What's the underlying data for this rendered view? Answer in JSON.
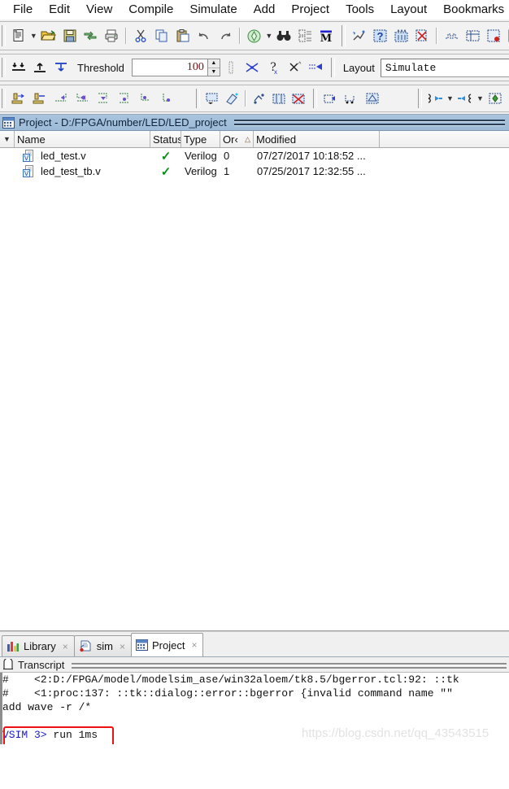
{
  "menu": {
    "items": [
      "File",
      "Edit",
      "View",
      "Compile",
      "Simulate",
      "Add",
      "Project",
      "Tools",
      "Layout",
      "Bookmarks"
    ]
  },
  "toolbar1": {
    "group1": [
      {
        "name": "new-document-icon",
        "label": "New"
      },
      {
        "name": "new-document-dropdown-icon",
        "label": "New menu"
      },
      {
        "name": "open-folder-icon",
        "label": "Open"
      },
      {
        "name": "save-icon",
        "label": "Save"
      },
      {
        "name": "reload-icon",
        "label": "Reload"
      },
      {
        "name": "print-icon",
        "label": "Print"
      }
    ],
    "group2": [
      {
        "name": "cut-icon",
        "label": "Cut"
      },
      {
        "name": "copy-icon",
        "label": "Copy"
      },
      {
        "name": "paste-icon",
        "label": "Paste"
      },
      {
        "name": "undo-icon",
        "label": "Undo"
      },
      {
        "name": "redo-icon",
        "label": "Redo"
      }
    ],
    "group3": [
      {
        "name": "compile-icon",
        "label": "Compile"
      },
      {
        "name": "compile-dropdown-icon",
        "label": "Compile menu"
      },
      {
        "name": "find-icon",
        "label": "Find"
      },
      {
        "name": "column-layout-icon",
        "label": "Columns"
      },
      {
        "name": "memory-icon",
        "label": "M"
      }
    ],
    "group4": [
      {
        "name": "simulate-icon",
        "label": "Simulate"
      },
      {
        "name": "wave-compare-icon",
        "label": "Compare"
      },
      {
        "name": "dataflow-icon",
        "label": "Dataflow"
      },
      {
        "name": "coverage-report-icon",
        "label": "Coverage report"
      },
      {
        "name": "delete-report-icon",
        "label": "Delete report"
      }
    ]
  },
  "toolbar2": {
    "icons_left": [
      {
        "name": "collapse-all-icon",
        "label": "Collapse all"
      },
      {
        "name": "expand-up-icon",
        "label": "Expand up"
      },
      {
        "name": "expand-down-icon",
        "label": "Expand down"
      }
    ],
    "threshold_label": "Threshold",
    "threshold_value": "100",
    "icons_right": [
      {
        "name": "column-filter-icon",
        "label": "Filter columns"
      },
      {
        "name": "dataflow-expand-icon",
        "label": "Expand net"
      },
      {
        "name": "unknown-signal-icon",
        "label": "Show unknowns"
      },
      {
        "name": "trace-x-icon",
        "label": "Trace X"
      },
      {
        "name": "step-into-icon",
        "label": "Step into"
      }
    ],
    "layout_label": "Layout",
    "layout_value": "Simulate"
  },
  "toolbar3": {
    "group1": [
      {
        "name": "step-in-icon",
        "label": "Step in"
      },
      {
        "name": "step-out-icon",
        "label": "Step out"
      },
      {
        "name": "jump-prev-icon",
        "label": "Previous"
      },
      {
        "name": "jump-next-icon",
        "label": "Next"
      },
      {
        "name": "expand-net-down-icon",
        "label": "Expand down"
      },
      {
        "name": "expand-net-right-icon",
        "label": "Expand right"
      },
      {
        "name": "trace-signal-icon",
        "label": "Trace signal"
      },
      {
        "name": "trace-event-icon",
        "label": "Trace event"
      }
    ],
    "group2": [
      {
        "name": "wave-add-icon",
        "label": "Add wave"
      },
      {
        "name": "wave-erase-icon",
        "label": "Erase wave"
      }
    ],
    "group3": [
      {
        "name": "restart-icon",
        "label": "Restart"
      },
      {
        "name": "dataflow-window-icon",
        "label": "Dataflow window"
      },
      {
        "name": "break-icon",
        "label": "Break"
      }
    ],
    "group4": [
      {
        "name": "run-icon",
        "label": "Run"
      },
      {
        "name": "run-continue-icon",
        "label": "Continue run"
      },
      {
        "name": "run-all-icon",
        "label": "Run all"
      }
    ],
    "group5": [
      {
        "name": "zoom-prev-icon",
        "label": "Zoom previous"
      },
      {
        "name": "zoom-prev-dropdown-icon",
        "label": "Zoom previous menu"
      },
      {
        "name": "zoom-next-icon",
        "label": "Zoom next"
      },
      {
        "name": "zoom-next-dropdown-icon",
        "label": "Zoom next menu"
      },
      {
        "name": "zoom-fit-icon",
        "label": "Zoom fit"
      }
    ]
  },
  "project": {
    "title": "Project - D:/FPGA/number/LED/LED_project",
    "columns": [
      "Name",
      "Status",
      "Type",
      "Or‹",
      "Modified"
    ],
    "sort_column": "Or‹",
    "rows": [
      {
        "name": "led_test.v",
        "status": "✓",
        "type": "Verilog",
        "order": "0",
        "modified": "07/27/2017 10:18:52 ..."
      },
      {
        "name": "led_test_tb.v",
        "status": "✓",
        "type": "Verilog",
        "order": "1",
        "modified": "07/25/2017 12:32:55 ..."
      }
    ]
  },
  "tabs": [
    {
      "label": "Library",
      "icon": "library-icon",
      "active": false,
      "close": "×"
    },
    {
      "label": "sim",
      "icon": "sim-icon",
      "active": false,
      "close": "×"
    },
    {
      "label": "Project",
      "icon": "project-icon",
      "active": true,
      "close": "×"
    }
  ],
  "transcript": {
    "title": "Transcript",
    "lines": [
      {
        "prefix": "#",
        "text": "    <2:D:/FPGA/model/modelsim_ase/win32aloem/tk8.5/bgerror.tcl:92: ::tk"
      },
      {
        "prefix": "#",
        "text": "    <1:proc:137: ::tk::dialog::error::bgerror {invalid command name \"\""
      },
      {
        "prefix": "",
        "text": "add wave -r /*"
      },
      {
        "prefix": "",
        "text": ""
      }
    ],
    "prompt_prefix": "VSIM 3>",
    "prompt_command": " run 1ms",
    "annotation_color": "#ee1111"
  },
  "watermark": "https://blog.csdn.net/qq_43543515"
}
